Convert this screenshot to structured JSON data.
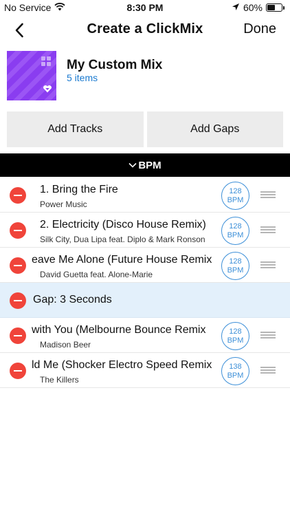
{
  "status_bar": {
    "carrier": "No Service",
    "time": "8:30 PM",
    "battery": "60%",
    "battery_level": 0.6
  },
  "nav": {
    "title": "Create a ClickMix",
    "done_label": "Done"
  },
  "mix": {
    "name": "My Custom Mix",
    "count": "5 items"
  },
  "actions": {
    "add_tracks": "Add Tracks",
    "add_gaps": "Add Gaps"
  },
  "sort": {
    "label": "BPM"
  },
  "tracks": [
    {
      "title": "1. Bring the Fire",
      "artist": "Power Music",
      "bpm": "128",
      "unit": "BPM"
    },
    {
      "title": "2. Electricity (Disco House Remix)",
      "artist": "Silk City, Dua Lipa feat. Diplo & Mark Ronson",
      "bpm": "128",
      "unit": "BPM"
    },
    {
      "title": "eave Me Alone (Future House Remix",
      "artist": "David Guetta feat. Alone-Marie",
      "bpm": "128",
      "unit": "BPM"
    },
    {
      "gap": "Gap: 3 Seconds"
    },
    {
      "title": "with You (Melbourne Bounce Remix",
      "artist": "Madison Beer",
      "bpm": "128",
      "unit": "BPM"
    },
    {
      "title": "ld Me (Shocker Electro Speed Remix",
      "artist": "The Killers",
      "bpm": "138",
      "unit": "BPM"
    }
  ],
  "colors": {
    "accent_blue": "#1a7ad0",
    "badge_blue": "#3c8fd8",
    "remove_red": "#f0443a",
    "gap_background": "#e3f0fb",
    "art_purple": "#8a3df0"
  },
  "icons": {
    "wifi": "wifi-icon",
    "location": "location-arrow-icon",
    "back": "chevron-left-icon",
    "sort": "chevron-down-icon",
    "remove": "minus-circle-icon",
    "drag": "drag-handle-icon"
  }
}
